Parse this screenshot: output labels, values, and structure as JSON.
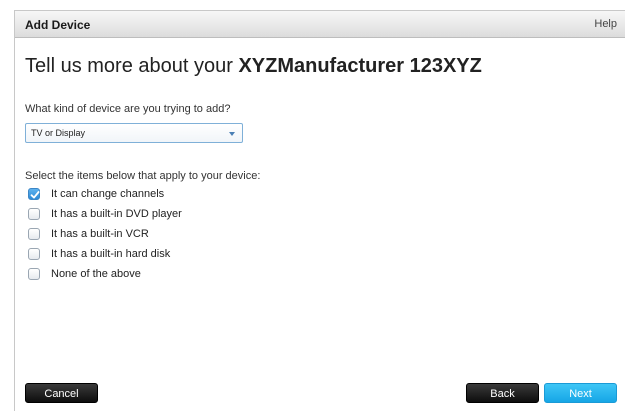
{
  "dialog": {
    "title": "Add Device",
    "help_label": "Help",
    "heading_prefix": "Tell us more about your ",
    "heading_device": "XYZManufacturer 123XYZ"
  },
  "device_type": {
    "question": "What kind of device are you trying to add?",
    "selected_value": "TV or Display"
  },
  "features": {
    "prompt": "Select the items below that apply to your device:",
    "options": [
      {
        "label": "It can change channels",
        "checked": true
      },
      {
        "label": "It has a built-in DVD player",
        "checked": false
      },
      {
        "label": "It has a built-in VCR",
        "checked": false
      },
      {
        "label": "It has a built-in hard disk",
        "checked": false
      },
      {
        "label": "None of the above",
        "checked": false
      }
    ]
  },
  "buttons": {
    "cancel": "Cancel",
    "back": "Back",
    "next": "Next"
  },
  "colors": {
    "primary_button": "#1fb0ee",
    "dark_button": "#111111",
    "checkbox_checked": "#2d8ad6"
  }
}
